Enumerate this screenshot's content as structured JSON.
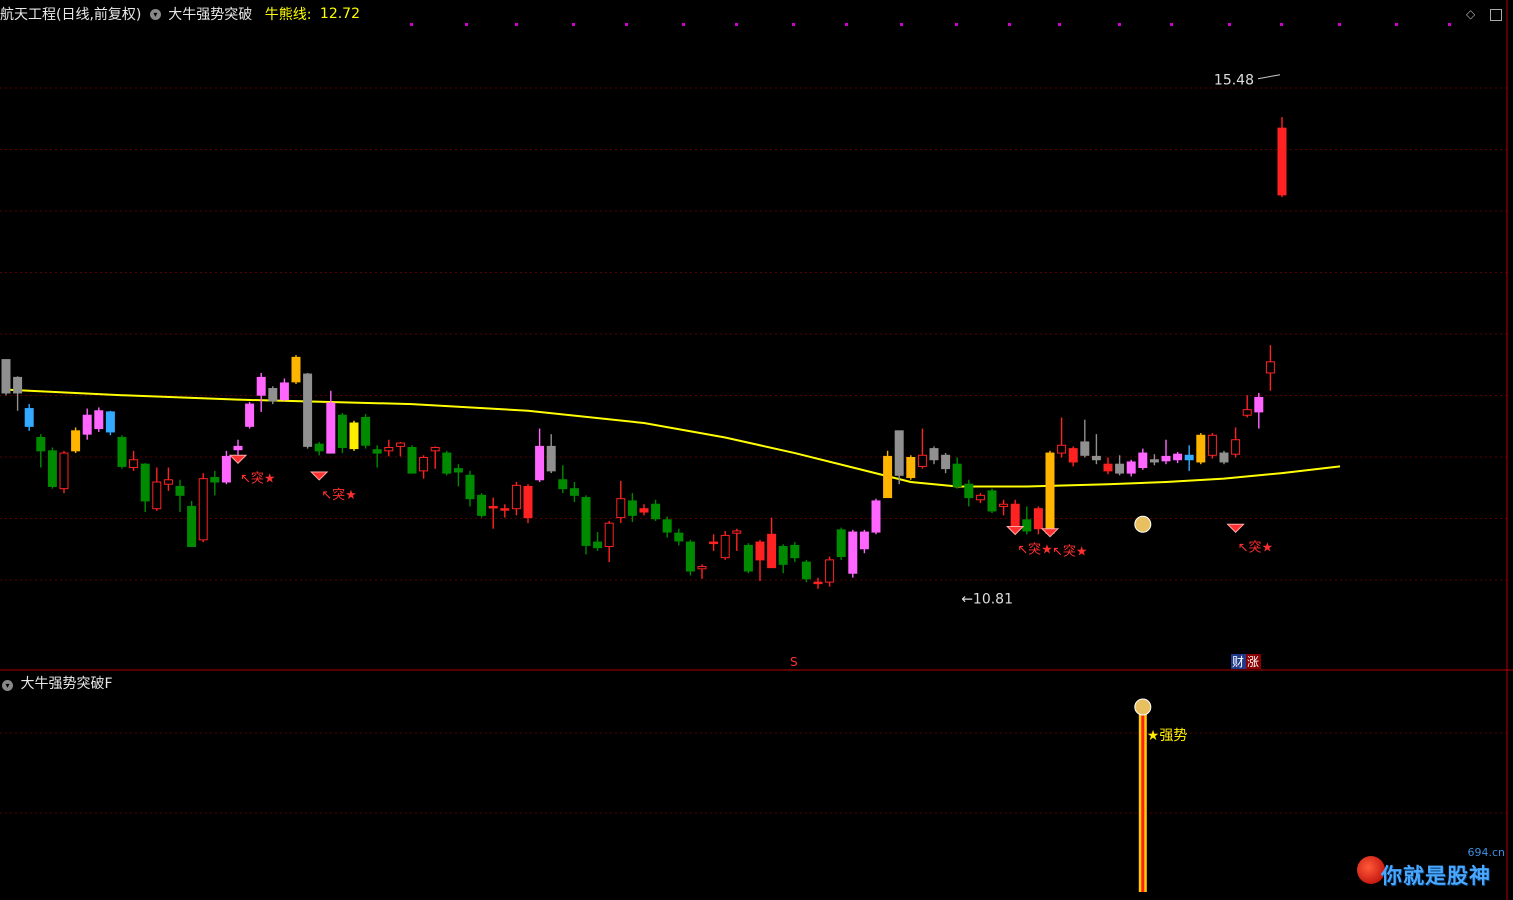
{
  "header": {
    "stock_title": "航天工程(日线,前复权)",
    "indicator_name": "大牛强势突破",
    "bull_bear_label": "牛熊线:",
    "bull_bear_value": "12.72"
  },
  "sub_panel": {
    "title": "大牛强势突破F",
    "signal_label": "★强势"
  },
  "labels": {
    "high_price": "15.48",
    "low_price": "10.81",
    "breakthrough_mark": "↖突★",
    "event_s": "S",
    "event_cai": "财",
    "event_zhang": "涨"
  },
  "watermark": {
    "small": "694.cn",
    "main": "你就是股神"
  },
  "icons": {
    "top_right_1": "diamond-icon",
    "top_right_2": "window-icon",
    "collapse": "chevron-down-icon"
  },
  "colors": {
    "background": "#000000",
    "grid": "#5a0000",
    "up": "#ff2222",
    "down": "#008a00",
    "pink": "#ff66ff",
    "orange": "#ffb400",
    "yellow": "#ffee00",
    "gray": "#909090",
    "cyan": "#33aaff",
    "ma_line": "#ffff00",
    "magenta_dots": "#d000d0"
  },
  "chart_data": {
    "type": "candlestick",
    "title": "航天工程(日线,前复权)",
    "y_range": [
      10.4,
      15.9
    ],
    "bull_bear_line_last": 12.72,
    "annotated_high": 15.48,
    "annotated_low": 10.81,
    "candles": [
      {
        "o": 12.92,
        "c": 12.62,
        "h": 12.92,
        "l": 12.6,
        "color": "gray"
      },
      {
        "o": 12.76,
        "c": 12.62,
        "h": 12.77,
        "l": 12.46,
        "color": "gray"
      },
      {
        "o": 12.32,
        "c": 12.48,
        "h": 12.52,
        "l": 12.28,
        "color": "cyan"
      },
      {
        "o": 12.22,
        "c": 12.1,
        "h": 12.25,
        "l": 11.95,
        "color": "green"
      },
      {
        "o": 12.1,
        "c": 11.78,
        "h": 12.13,
        "l": 11.76,
        "color": "green"
      },
      {
        "o": 11.76,
        "c": 12.08,
        "h": 12.1,
        "l": 11.72,
        "color": "red"
      },
      {
        "o": 12.1,
        "c": 12.28,
        "h": 12.31,
        "l": 12.08,
        "color": "orange"
      },
      {
        "o": 12.25,
        "c": 12.42,
        "h": 12.48,
        "l": 12.2,
        "color": "pink"
      },
      {
        "o": 12.3,
        "c": 12.46,
        "h": 12.49,
        "l": 12.27,
        "color": "pink"
      },
      {
        "o": 12.45,
        "c": 12.27,
        "h": 12.46,
        "l": 12.24,
        "color": "cyan"
      },
      {
        "o": 12.22,
        "c": 11.96,
        "h": 12.24,
        "l": 11.94,
        "color": "green"
      },
      {
        "o": 11.95,
        "c": 12.02,
        "h": 12.1,
        "l": 11.92,
        "color": "red"
      },
      {
        "o": 11.98,
        "c": 11.65,
        "h": 11.99,
        "l": 11.55,
        "color": "green"
      },
      {
        "o": 11.58,
        "c": 11.82,
        "h": 11.95,
        "l": 11.56,
        "color": "red"
      },
      {
        "o": 11.8,
        "c": 11.84,
        "h": 11.95,
        "l": 11.74,
        "color": "red"
      },
      {
        "o": 11.78,
        "c": 11.7,
        "h": 11.84,
        "l": 11.55,
        "color": "green"
      },
      {
        "o": 11.6,
        "c": 11.24,
        "h": 11.65,
        "l": 11.24,
        "color": "green"
      },
      {
        "o": 11.3,
        "c": 11.85,
        "h": 11.9,
        "l": 11.28,
        "color": "red"
      },
      {
        "o": 11.86,
        "c": 11.82,
        "h": 11.92,
        "l": 11.7,
        "color": "green"
      },
      {
        "o": 11.82,
        "c": 12.05,
        "h": 12.1,
        "l": 11.8,
        "color": "pink"
      },
      {
        "o": 12.14,
        "c": 12.11,
        "h": 12.2,
        "l": 12.05,
        "color": "pink"
      },
      {
        "o": 12.32,
        "c": 12.52,
        "h": 12.54,
        "l": 12.3,
        "color": "pink"
      },
      {
        "o": 12.6,
        "c": 12.76,
        "h": 12.8,
        "l": 12.45,
        "color": "pink"
      },
      {
        "o": 12.55,
        "c": 12.66,
        "h": 12.68,
        "l": 12.52,
        "color": "gray"
      },
      {
        "o": 12.56,
        "c": 12.71,
        "h": 12.75,
        "l": 12.55,
        "color": "pink"
      },
      {
        "o": 12.72,
        "c": 12.94,
        "h": 12.96,
        "l": 12.7,
        "color": "orange"
      },
      {
        "o": 12.79,
        "c": 12.14,
        "h": 12.8,
        "l": 12.12,
        "color": "gray"
      },
      {
        "o": 12.16,
        "c": 12.1,
        "h": 12.18,
        "l": 12.06,
        "color": "green"
      },
      {
        "o": 12.08,
        "c": 12.53,
        "h": 12.64,
        "l": 12.08,
        "color": "pink"
      },
      {
        "o": 12.42,
        "c": 12.13,
        "h": 12.44,
        "l": 12.08,
        "color": "green"
      },
      {
        "o": 12.12,
        "c": 12.35,
        "h": 12.37,
        "l": 12.1,
        "color": "yellow"
      },
      {
        "o": 12.4,
        "c": 12.15,
        "h": 12.43,
        "l": 12.12,
        "color": "green"
      },
      {
        "o": 12.11,
        "c": 12.08,
        "h": 12.15,
        "l": 11.95,
        "color": "green"
      },
      {
        "o": 12.1,
        "c": 12.13,
        "h": 12.2,
        "l": 12.05,
        "color": "red"
      },
      {
        "o": 12.14,
        "c": 12.17,
        "h": 12.18,
        "l": 12.05,
        "color": "red"
      },
      {
        "o": 12.13,
        "c": 11.9,
        "h": 12.15,
        "l": 11.9,
        "color": "green"
      },
      {
        "o": 11.92,
        "c": 12.04,
        "h": 12.06,
        "l": 11.85,
        "color": "red"
      },
      {
        "o": 12.1,
        "c": 12.13,
        "h": 12.14,
        "l": 11.94,
        "color": "red"
      },
      {
        "o": 12.08,
        "c": 11.9,
        "h": 12.1,
        "l": 11.88,
        "color": "green"
      },
      {
        "o": 11.94,
        "c": 11.91,
        "h": 11.98,
        "l": 11.78,
        "color": "green"
      },
      {
        "o": 11.88,
        "c": 11.67,
        "h": 11.92,
        "l": 11.6,
        "color": "green"
      },
      {
        "o": 11.7,
        "c": 11.52,
        "h": 11.72,
        "l": 11.5,
        "color": "green"
      },
      {
        "o": 11.6,
        "c": 11.6,
        "h": 11.68,
        "l": 11.4,
        "color": "red"
      },
      {
        "o": 11.58,
        "c": 11.58,
        "h": 11.62,
        "l": 11.5,
        "color": "red"
      },
      {
        "o": 11.58,
        "c": 11.79,
        "h": 11.82,
        "l": 11.52,
        "color": "red"
      },
      {
        "o": 11.78,
        "c": 11.5,
        "h": 11.8,
        "l": 11.45,
        "color": "red"
      },
      {
        "o": 11.84,
        "c": 12.14,
        "h": 12.3,
        "l": 11.82,
        "color": "pink"
      },
      {
        "o": 12.14,
        "c": 11.92,
        "h": 12.25,
        "l": 11.9,
        "color": "gray"
      },
      {
        "o": 11.84,
        "c": 11.76,
        "h": 11.97,
        "l": 11.72,
        "color": "green"
      },
      {
        "o": 11.76,
        "c": 11.7,
        "h": 11.82,
        "l": 11.64,
        "color": "green"
      },
      {
        "o": 11.68,
        "c": 11.25,
        "h": 11.7,
        "l": 11.17,
        "color": "green"
      },
      {
        "o": 11.28,
        "c": 11.23,
        "h": 11.37,
        "l": 11.2,
        "color": "green"
      },
      {
        "o": 11.24,
        "c": 11.45,
        "h": 11.47,
        "l": 11.1,
        "color": "red"
      },
      {
        "o": 11.5,
        "c": 11.67,
        "h": 11.83,
        "l": 11.45,
        "color": "red"
      },
      {
        "o": 11.65,
        "c": 11.52,
        "h": 11.72,
        "l": 11.46,
        "color": "green"
      },
      {
        "o": 11.58,
        "c": 11.55,
        "h": 11.62,
        "l": 11.52,
        "color": "red"
      },
      {
        "o": 11.62,
        "c": 11.49,
        "h": 11.66,
        "l": 11.47,
        "color": "green"
      },
      {
        "o": 11.48,
        "c": 11.37,
        "h": 11.51,
        "l": 11.32,
        "color": "green"
      },
      {
        "o": 11.36,
        "c": 11.29,
        "h": 11.4,
        "l": 11.25,
        "color": "green"
      },
      {
        "o": 11.28,
        "c": 11.02,
        "h": 11.3,
        "l": 10.98,
        "color": "green"
      },
      {
        "o": 11.04,
        "c": 11.06,
        "h": 11.08,
        "l": 10.95,
        "color": "red"
      },
      {
        "o": 11.28,
        "c": 11.28,
        "h": 11.35,
        "l": 11.2,
        "color": "red"
      },
      {
        "o": 11.14,
        "c": 11.34,
        "h": 11.38,
        "l": 11.12,
        "color": "red"
      },
      {
        "o": 11.36,
        "c": 11.38,
        "h": 11.4,
        "l": 11.2,
        "color": "red"
      },
      {
        "o": 11.25,
        "c": 11.02,
        "h": 11.27,
        "l": 11.0,
        "color": "green"
      },
      {
        "o": 11.28,
        "c": 11.12,
        "h": 11.3,
        "l": 10.93,
        "color": "red"
      },
      {
        "o": 11.35,
        "c": 11.05,
        "h": 11.5,
        "l": 11.1,
        "color": "red"
      },
      {
        "o": 11.08,
        "c": 11.24,
        "h": 11.26,
        "l": 11.0,
        "color": "green"
      },
      {
        "o": 11.25,
        "c": 11.14,
        "h": 11.28,
        "l": 11.1,
        "color": "green"
      },
      {
        "o": 11.1,
        "c": 10.95,
        "h": 11.12,
        "l": 10.92,
        "color": "green"
      },
      {
        "o": 10.92,
        "c": 10.92,
        "h": 10.96,
        "l": 10.86,
        "color": "red"
      },
      {
        "o": 10.92,
        "c": 11.12,
        "h": 11.15,
        "l": 10.88,
        "color": "red"
      },
      {
        "o": 11.15,
        "c": 11.39,
        "h": 11.41,
        "l": 11.12,
        "color": "green"
      },
      {
        "o": 11.0,
        "c": 11.37,
        "h": 11.39,
        "l": 10.96,
        "color": "pink"
      },
      {
        "o": 11.22,
        "c": 11.37,
        "h": 11.39,
        "l": 11.18,
        "color": "pink"
      },
      {
        "o": 11.37,
        "c": 11.65,
        "h": 11.67,
        "l": 11.35,
        "color": "pink"
      },
      {
        "o": 11.68,
        "c": 12.05,
        "h": 12.1,
        "l": 11.7,
        "color": "orange"
      },
      {
        "o": 12.28,
        "c": 11.88,
        "h": 12.2,
        "l": 11.8,
        "color": "gray"
      },
      {
        "o": 11.86,
        "c": 12.04,
        "h": 12.06,
        "l": 11.84,
        "color": "orange"
      },
      {
        "o": 11.96,
        "c": 12.06,
        "h": 12.3,
        "l": 11.94,
        "color": "red"
      },
      {
        "o": 12.12,
        "c": 12.02,
        "h": 12.14,
        "l": 11.98,
        "color": "gray"
      },
      {
        "o": 12.06,
        "c": 11.94,
        "h": 12.08,
        "l": 11.9,
        "color": "gray"
      },
      {
        "o": 11.98,
        "c": 11.78,
        "h": 12.04,
        "l": 11.76,
        "color": "green"
      },
      {
        "o": 11.8,
        "c": 11.68,
        "h": 11.84,
        "l": 11.6,
        "color": "green"
      },
      {
        "o": 11.66,
        "c": 11.7,
        "h": 11.72,
        "l": 11.63,
        "color": "red"
      },
      {
        "o": 11.74,
        "c": 11.56,
        "h": 11.76,
        "l": 11.54,
        "color": "green"
      },
      {
        "o": 11.6,
        "c": 11.62,
        "h": 11.66,
        "l": 11.52,
        "color": "red"
      },
      {
        "o": 11.62,
        "c": 11.4,
        "h": 11.66,
        "l": 11.4,
        "color": "red"
      },
      {
        "o": 11.38,
        "c": 11.48,
        "h": 11.6,
        "l": 11.35,
        "color": "green"
      },
      {
        "o": 11.58,
        "c": 11.4,
        "h": 11.6,
        "l": 11.35,
        "color": "red"
      },
      {
        "o": 11.36,
        "c": 12.08,
        "h": 12.1,
        "l": 11.34,
        "color": "orange"
      },
      {
        "o": 12.08,
        "c": 12.15,
        "h": 12.4,
        "l": 12.04,
        "color": "red"
      },
      {
        "o": 12.12,
        "c": 12.0,
        "h": 12.14,
        "l": 11.96,
        "color": "red"
      },
      {
        "o": 12.18,
        "c": 12.06,
        "h": 12.38,
        "l": 12.04,
        "color": "gray"
      },
      {
        "o": 12.02,
        "c": 12.05,
        "h": 12.25,
        "l": 11.98,
        "color": "gray"
      },
      {
        "o": 11.98,
        "c": 11.92,
        "h": 12.04,
        "l": 11.89,
        "color": "red"
      },
      {
        "o": 11.9,
        "c": 11.98,
        "h": 12.06,
        "l": 11.88,
        "color": "gray"
      },
      {
        "o": 11.9,
        "c": 12.0,
        "h": 12.02,
        "l": 11.87,
        "color": "pink"
      },
      {
        "o": 11.95,
        "c": 12.08,
        "h": 12.12,
        "l": 11.93,
        "color": "pink"
      },
      {
        "o": 12.0,
        "c": 12.02,
        "h": 12.07,
        "l": 11.97,
        "color": "gray"
      },
      {
        "o": 12.01,
        "c": 12.05,
        "h": 12.2,
        "l": 11.98,
        "color": "pink"
      },
      {
        "o": 12.02,
        "c": 12.07,
        "h": 12.09,
        "l": 11.99,
        "color": "pink"
      },
      {
        "o": 12.02,
        "c": 12.06,
        "h": 12.15,
        "l": 11.92,
        "color": "cyan"
      },
      {
        "o": 12.0,
        "c": 12.24,
        "h": 12.26,
        "l": 11.98,
        "color": "orange"
      },
      {
        "o": 12.06,
        "c": 12.24,
        "h": 12.26,
        "l": 12.03,
        "color": "red"
      },
      {
        "o": 12.0,
        "c": 12.08,
        "h": 12.1,
        "l": 11.98,
        "color": "gray"
      },
      {
        "o": 12.07,
        "c": 12.2,
        "h": 12.31,
        "l": 12.04,
        "color": "red"
      },
      {
        "o": 12.42,
        "c": 12.47,
        "h": 12.6,
        "l": 12.4,
        "color": "red"
      },
      {
        "o": 12.58,
        "c": 12.45,
        "h": 12.62,
        "l": 12.3,
        "color": "pink"
      },
      {
        "o": 12.8,
        "c": 12.9,
        "h": 13.05,
        "l": 12.64,
        "color": "red"
      },
      {
        "o": 15.0,
        "c": 14.4,
        "h": 15.1,
        "l": 14.38,
        "color": "red"
      }
    ],
    "ma_line": [
      {
        "i": 0,
        "v": 12.65
      },
      {
        "i": 10,
        "v": 12.6
      },
      {
        "i": 20,
        "v": 12.56
      },
      {
        "i": 35,
        "v": 12.52
      },
      {
        "i": 45,
        "v": 12.46
      },
      {
        "i": 55,
        "v": 12.35
      },
      {
        "i": 62,
        "v": 12.22
      },
      {
        "i": 68,
        "v": 12.08
      },
      {
        "i": 73,
        "v": 11.95
      },
      {
        "i": 78,
        "v": 11.82
      },
      {
        "i": 82,
        "v": 11.78
      },
      {
        "i": 88,
        "v": 11.78
      },
      {
        "i": 95,
        "v": 11.8
      },
      {
        "i": 100,
        "v": 11.82
      },
      {
        "i": 105,
        "v": 11.85
      },
      {
        "i": 110,
        "v": 11.9
      },
      {
        "i": 115,
        "v": 11.96
      }
    ],
    "sub_panel_signal": {
      "index": 98,
      "label": "★强势"
    }
  }
}
